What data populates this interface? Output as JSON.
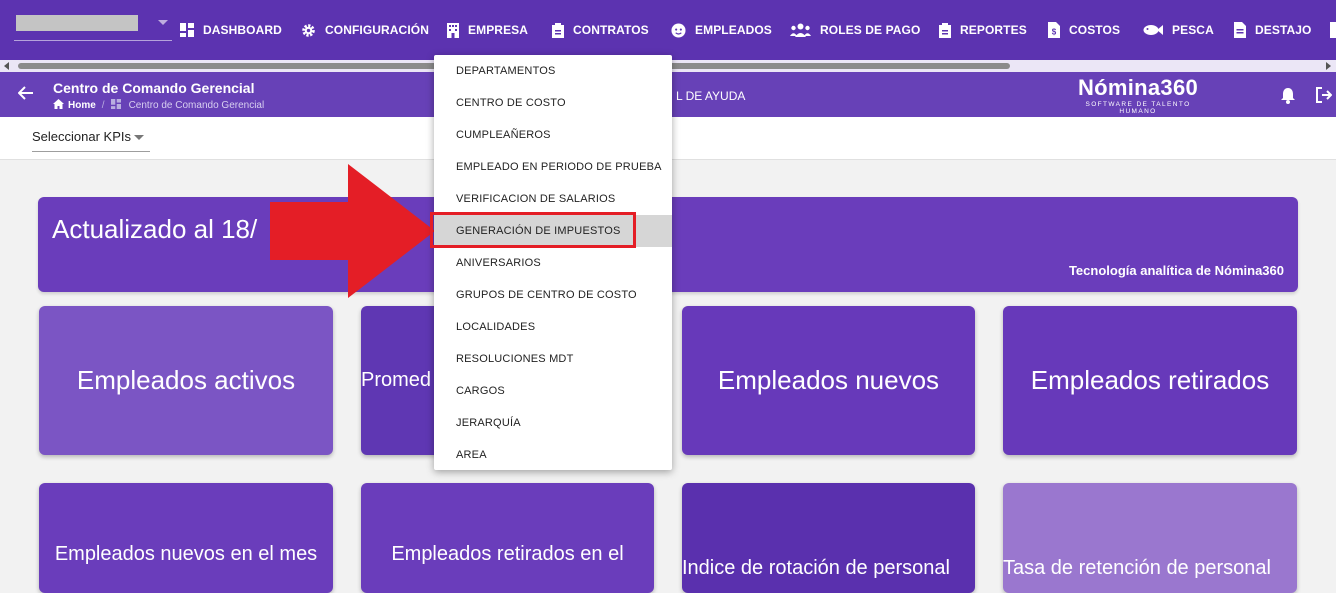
{
  "nav": [
    {
      "key": "dashboard",
      "label": "DASHBOARD",
      "icon": "dashboard-icon"
    },
    {
      "key": "configuracion",
      "label": "CONFIGURACIÓN",
      "icon": "gear-icon"
    },
    {
      "key": "empresa",
      "label": "EMPRESA",
      "icon": "building-icon"
    },
    {
      "key": "contratos",
      "label": "CONTRATOS",
      "icon": "clipboard-icon"
    },
    {
      "key": "empleados",
      "label": "EMPLEADOS",
      "icon": "face-icon"
    },
    {
      "key": "roles",
      "label": "ROLES DE PAGO",
      "icon": "people-icon"
    },
    {
      "key": "reportes",
      "label": "REPORTES",
      "icon": "clipboard-icon"
    },
    {
      "key": "costos",
      "label": "COSTOS",
      "icon": "invoice-icon"
    },
    {
      "key": "pesca",
      "label": "PESCA",
      "icon": "fish-icon"
    },
    {
      "key": "destajo",
      "label": "DESTAJO",
      "icon": "document-icon"
    }
  ],
  "header": {
    "title": "Centro de Comando Gerencial",
    "breadcrumb_home": "Home",
    "breadcrumb_sep": "/",
    "breadcrumb_current": "Centro de Comando Gerencial",
    "help_text": "L DE AYUDA",
    "logo_name": "Nómina360",
    "logo_tagline": "SOFTWARE DE TALENTO HUMANO"
  },
  "filters": {
    "kpi_select": "Seleccionar KPIs"
  },
  "banner": {
    "heading": "Actualizado al 18/",
    "footer": "Tecnología analítica de Nómina360"
  },
  "cards_row1": [
    "Empleados activos",
    "Promed",
    "Empleados nuevos",
    "Empleados retirados"
  ],
  "cards_row2": [
    "Empleados nuevos en el mes",
    "Empleados retirados en el",
    "Indice de rotación de personal",
    "Tasa de retención de personal"
  ],
  "empresa_menu": {
    "items": [
      "DEPARTAMENTOS",
      "CENTRO DE COSTO",
      "CUMPLEAÑEROS",
      "EMPLEADO EN PERIODO DE PRUEBA",
      "VERIFICACION DE SALARIOS",
      "GENERACIÓN DE IMPUESTOS",
      "ANIVERSARIOS",
      "GRUPOS DE CENTRO DE COSTO",
      "LOCALIDADES",
      "RESOLUCIONES MDT",
      "CARGOS",
      "JERARQUÍA",
      "AREA"
    ],
    "selected_index": 5
  },
  "colors": {
    "topbar": "#5c33b0",
    "subbar": "#6741b7",
    "banner": "#6a3dbb",
    "annotation_red": "#e41e26",
    "card_light": "#7b55c4",
    "card_mid": "#5f37b3",
    "card_deep": "#6739ba",
    "card_lavender": "#9a77cf"
  }
}
